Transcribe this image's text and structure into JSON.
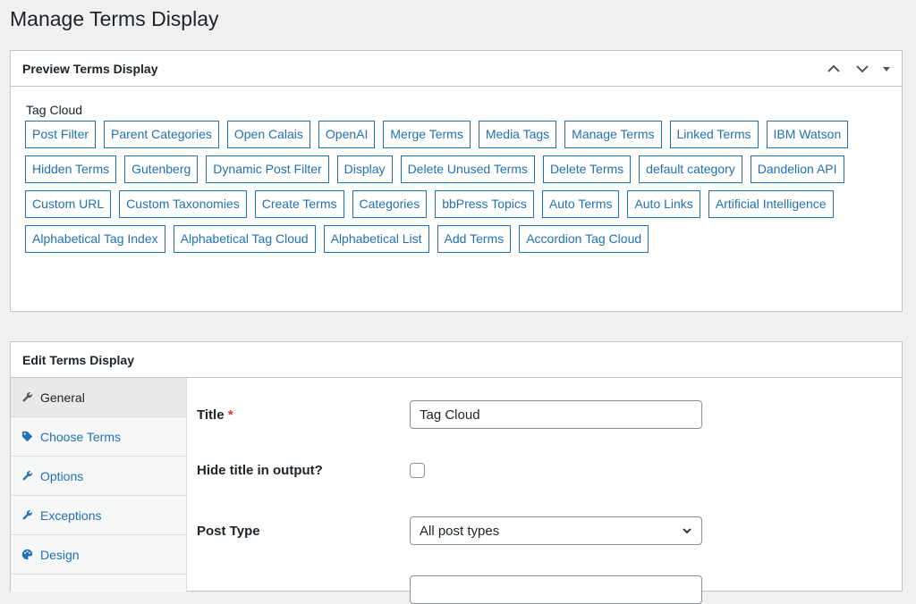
{
  "page_title": "Manage Terms Display",
  "preview": {
    "title": "Preview Terms Display",
    "cloud_title": "Tag Cloud",
    "tags": [
      "Post Filter",
      "Parent Categories",
      "Open Calais",
      "OpenAI",
      "Merge Terms",
      "Media Tags",
      "Manage Terms",
      "Linked Terms",
      "IBM Watson",
      "Hidden Terms",
      "Gutenberg",
      "Dynamic Post Filter",
      "Display",
      "Delete Unused Terms",
      "Delete Terms",
      "default category",
      "Dandelion API",
      "Custom URL",
      "Custom Taxonomies",
      "Create Terms",
      "Categories",
      "bbPress Topics",
      "Auto Terms",
      "Auto Links",
      "Artificial Intelligence",
      "Alphabetical Tag Index",
      "Alphabetical Tag Cloud",
      "Alphabetical List",
      "Add Terms",
      "Accordion Tag Cloud"
    ]
  },
  "edit": {
    "title": "Edit Terms Display",
    "tabs": [
      {
        "label": "General",
        "icon": "wrench-icon",
        "active": true
      },
      {
        "label": "Choose Terms",
        "icon": "tag-icon",
        "active": false
      },
      {
        "label": "Options",
        "icon": "wrench-icon",
        "active": false
      },
      {
        "label": "Exceptions",
        "icon": "wrench-icon",
        "active": false
      },
      {
        "label": "Design",
        "icon": "palette-icon",
        "active": false
      }
    ],
    "fields": {
      "title_label": "Title",
      "required_mark": "*",
      "title_value": "Tag Cloud",
      "hide_title_label": "Hide title in output?",
      "hide_title_checked": false,
      "post_type_label": "Post Type",
      "post_type_value": "All post types"
    }
  },
  "colors": {
    "accent": "#2271b1",
    "required": "#d63638",
    "border": "#c3c4c7",
    "background": "#f0f0f1"
  }
}
